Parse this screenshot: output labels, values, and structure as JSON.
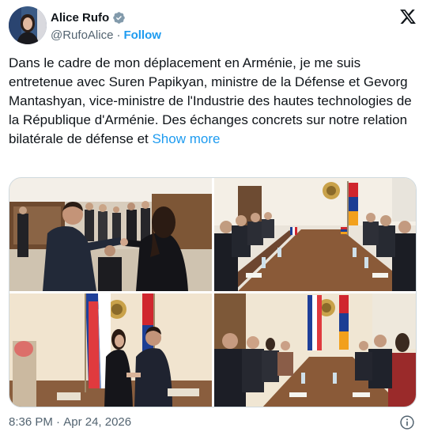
{
  "author": {
    "display_name": "Alice Rufo",
    "handle": "@RufoAlice",
    "separator": "·",
    "follow_label": "Follow"
  },
  "tweet": {
    "text": "Dans le cadre de mon déplacement en Arménie, je me suis entretenue avec Suren Papikyan, ministre de la Défense et Gevorg Mantashyan, vice-ministre de l'Industrie des hautes technologies de la République d'Arménie. Des échanges concrets sur notre relation bilatérale de défense et ",
    "show_more_label": "Show more"
  },
  "footer": {
    "time": "8:36 PM",
    "separator": " · ",
    "date": "Apr 24, 2026"
  },
  "icons": {
    "verified": "verified-badge-icon",
    "x_logo": "x-logo-icon",
    "info": "info-icon"
  },
  "colors": {
    "link": "#1d9bf0",
    "secondary_text": "#536471",
    "text": "#0f1419",
    "border": "#cfd9de"
  }
}
